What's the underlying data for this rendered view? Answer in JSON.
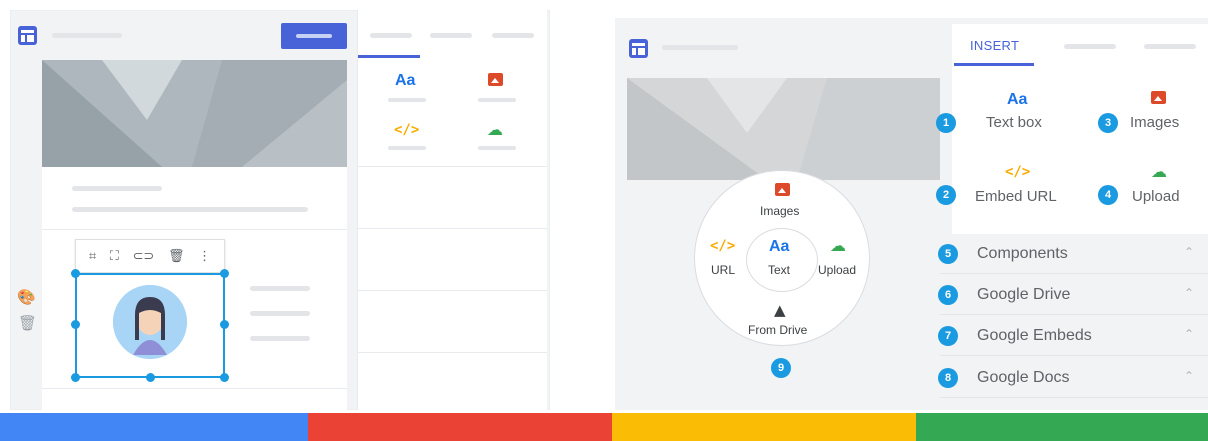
{
  "left_mockup": {
    "insert_panel": {
      "text_icon": "Aa",
      "embed_icon": "</>"
    },
    "toolbar_icons": [
      "crop-icon",
      "fullscreen-icon",
      "link-icon",
      "delete-icon",
      "more-vert-icon"
    ],
    "side_icons": [
      "palette-icon",
      "trash-icon"
    ]
  },
  "right_mockup": {
    "tab_insert": "INSERT",
    "cards": {
      "text_box": {
        "number": "1",
        "icon": "Aa",
        "label": "Text box"
      },
      "embed_url": {
        "number": "2",
        "icon": "</>",
        "label": "Embed URL"
      },
      "images": {
        "number": "3",
        "label": "Images"
      },
      "upload": {
        "number": "4",
        "label": "Upload"
      }
    },
    "rows": [
      {
        "number": "5",
        "label": "Components"
      },
      {
        "number": "6",
        "label": "Google Drive"
      },
      {
        "number": "7",
        "label": "Google Embeds"
      },
      {
        "number": "8",
        "label": "Google Docs"
      }
    ],
    "wheel": {
      "images": "Images",
      "url_icon": "</>",
      "url": "URL",
      "center_icon": "Aa",
      "center": "Text",
      "upload": "Upload",
      "from_drive": "From Drive",
      "number": "9"
    }
  },
  "colors": {
    "accent": "#4763d7",
    "badge": "#1a9ae0",
    "stripe_blue": "#4285f4",
    "stripe_red": "#ea4335",
    "stripe_yellow": "#fbbc05",
    "stripe_green": "#34a853"
  }
}
